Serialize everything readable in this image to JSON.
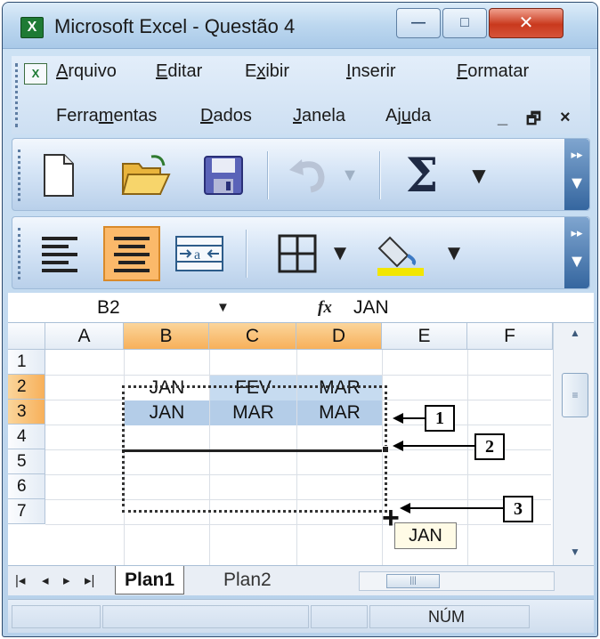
{
  "window": {
    "title": "Microsoft Excel - Questão 4",
    "app_icon": "X",
    "minimize": "—",
    "maximize": "□",
    "close": "✕"
  },
  "menu": {
    "items": [
      {
        "pre": "",
        "u": "A",
        "post": "rquivo"
      },
      {
        "pre": "",
        "u": "E",
        "post": "ditar"
      },
      {
        "pre": "E",
        "u": "x",
        "post": "ibir"
      },
      {
        "pre": "",
        "u": "I",
        "post": "nserir"
      },
      {
        "pre": "",
        "u": "F",
        "post": "ormatar"
      },
      {
        "pre": "Ferra",
        "u": "m",
        "post": "entas"
      },
      {
        "pre": "",
        "u": "D",
        "post": "ados"
      },
      {
        "pre": "",
        "u": "J",
        "post": "anela"
      },
      {
        "pre": "Aj",
        "u": "u",
        "post": "da"
      }
    ],
    "doc_icon": "X",
    "mdi_minimize": "_",
    "mdi_restore": "🗗",
    "mdi_close": "×"
  },
  "toolbar1": {
    "icons": [
      "new-document-icon",
      "open-folder-icon",
      "save-disk-icon",
      "undo-icon",
      "autosum-icon"
    ],
    "sum_symbol": "Σ",
    "dropdown": "▼",
    "chevron": "▸▸"
  },
  "toolbar2": {
    "icons": [
      "align-left-icon",
      "align-center-icon",
      "merge-center-icon",
      "borders-icon",
      "fill-color-icon"
    ],
    "merge_label": "a",
    "dropdown": "▼",
    "chevron": "▸▸"
  },
  "formula_bar": {
    "name_box": "B2",
    "name_box_arrow": "▼",
    "fx": "fx",
    "value": "JAN"
  },
  "sheet": {
    "columns": [
      "A",
      "B",
      "C",
      "D",
      "E",
      "F"
    ],
    "rows": [
      "1",
      "2",
      "3",
      "4",
      "5",
      "6",
      "7"
    ],
    "selected_columns": [
      "B",
      "C",
      "D"
    ],
    "selected_rows": [
      "2",
      "3"
    ],
    "cells": {
      "B2": "JAN",
      "C2": "FEV",
      "D2": "MAR",
      "B3": "JAN",
      "C3": "MAR",
      "D3": "MAR"
    },
    "autofill_tip": "JAN",
    "autofill_cursor": "+"
  },
  "callouts": [
    "1",
    "2",
    "3"
  ],
  "tabs": {
    "nav": [
      "|◂",
      "◂",
      "▸",
      "▸|"
    ],
    "sheets": [
      "Plan1",
      "Plan2"
    ],
    "active": "Plan1"
  },
  "status": {
    "num": "NÚM"
  },
  "colors": {
    "selection_header": "#f7b05a",
    "selection_fill": "#c6dbf0",
    "title_bar": "#bcd7ef",
    "close_button": "#c9391d"
  }
}
